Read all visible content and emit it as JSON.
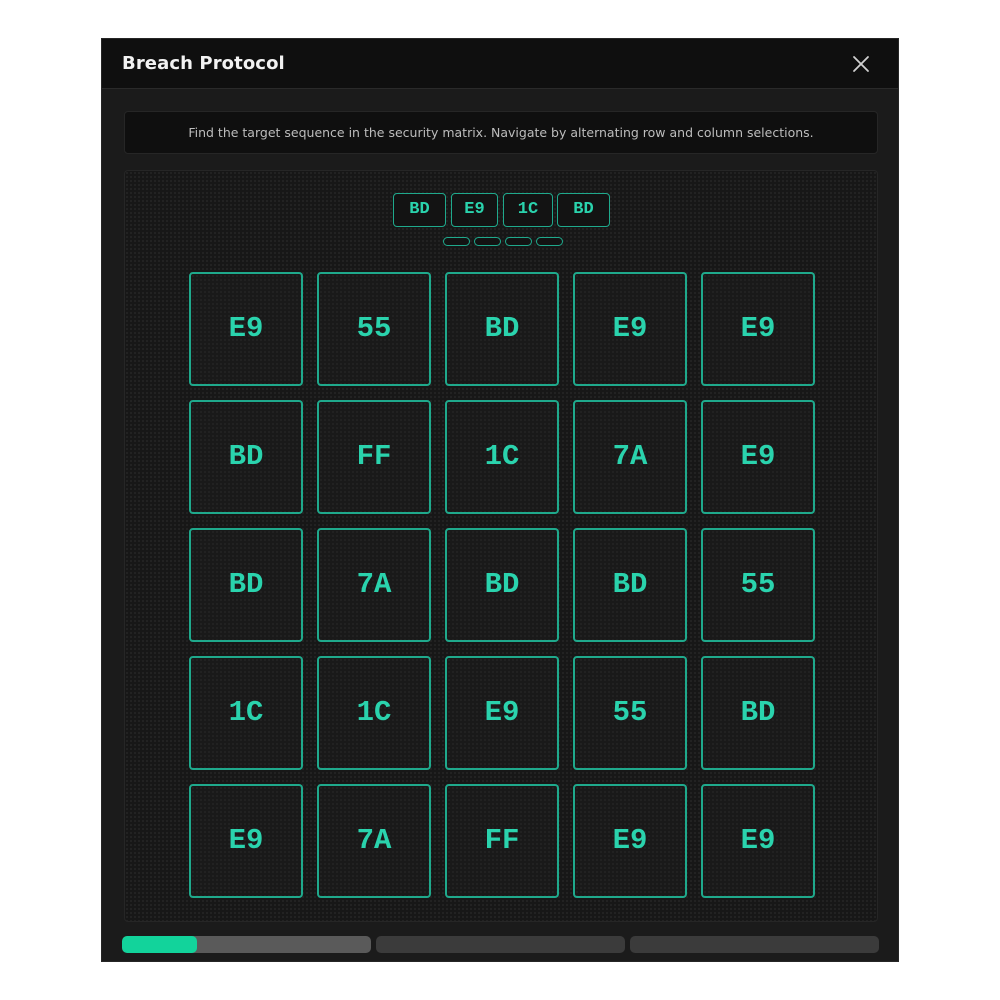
{
  "window": {
    "title": "Breach Protocol",
    "close_icon": "close-icon"
  },
  "instructions": "Find the target sequence in the security matrix. Navigate by alternating row and column selections.",
  "target_sequence": [
    "BD",
    "E9",
    "1C",
    "BD"
  ],
  "matrix": [
    [
      "E9",
      "55",
      "BD",
      "E9",
      "E9"
    ],
    [
      "BD",
      "FF",
      "1C",
      "7A",
      "E9"
    ],
    [
      "BD",
      "7A",
      "BD",
      "BD",
      "55"
    ],
    [
      "1C",
      "1C",
      "E9",
      "55",
      "BD"
    ],
    [
      "E9",
      "7A",
      "FF",
      "E9",
      "E9"
    ]
  ],
  "progress": {
    "segments": 3,
    "current_segment_fill": 0.3,
    "completed_segments": 0
  },
  "colors": {
    "accent": "#2ad3ad",
    "border": "#1fa98c",
    "progress_fill": "#12d39b",
    "background": "#1b1b1b"
  }
}
